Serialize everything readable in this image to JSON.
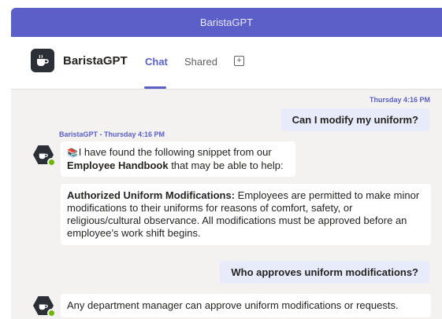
{
  "window": {
    "title": "BaristaGPT"
  },
  "header": {
    "app_name": "BaristaGPT",
    "tabs": [
      {
        "label": "Chat",
        "active": true
      },
      {
        "label": "Shared",
        "active": false
      }
    ],
    "add_tab_symbol": "+"
  },
  "colors": {
    "accent": "#5b5fc7",
    "my_bubble": "#e8ebfa",
    "bot_bubble": "#ffffff",
    "background": "#f3f2f1",
    "online": "#6bb700"
  },
  "messages": {
    "m1": {
      "timestamp": "Thursday 4:16 PM",
      "text": "Can I modify my uniform?"
    },
    "m2": {
      "sender_line": "BaristaGPT - Thursday 4:16 PM",
      "icon": "books-icon",
      "intro_before": "I have found the following snippet from our",
      "intro_bold": "Employee Handbook",
      "intro_after": " that may be able to help:",
      "snippet_title": "Authorized Uniform Modifications:",
      "snippet_body": " Employees are permitted to make minor modifications to their uniforms for reasons of comfort, safety, or religious/cultural observance. All modifications must be approved before an employee’s work shift begins."
    },
    "m3": {
      "text": "Who approves uniform modifications?"
    },
    "m4": {
      "text": "Any department manager can approve uniform modifications or requests."
    }
  }
}
